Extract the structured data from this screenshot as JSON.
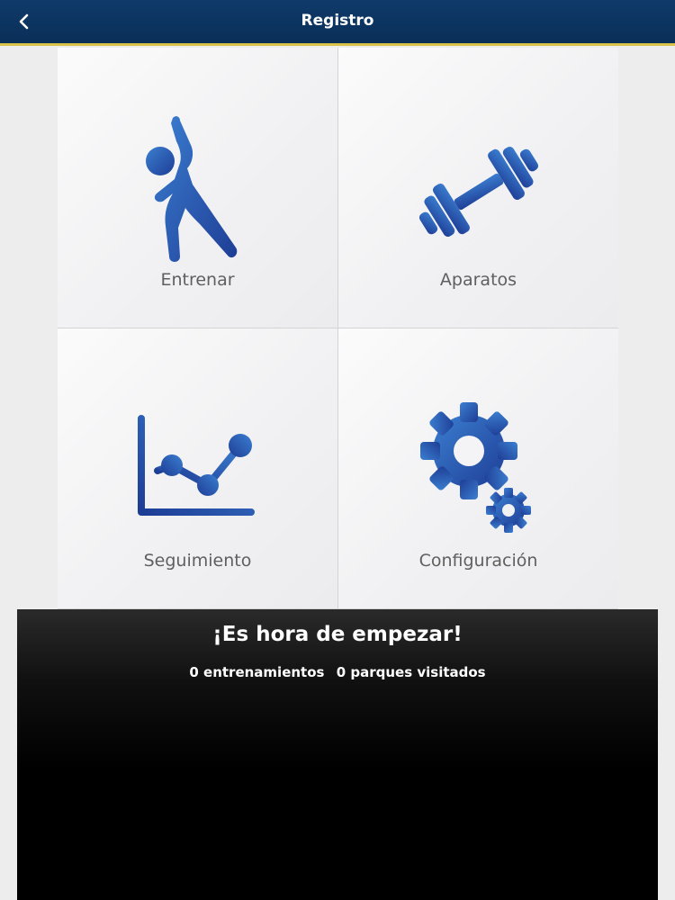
{
  "header": {
    "title": "Registro",
    "back_icon": "chevron-left-icon"
  },
  "menu": [
    {
      "label": "Entrenar",
      "icon": "stretching-person-icon"
    },
    {
      "label": "Aparatos",
      "icon": "dumbbell-icon"
    },
    {
      "label": "Seguimiento",
      "icon": "line-chart-icon"
    },
    {
      "label": "Configuración",
      "icon": "gears-icon"
    }
  ],
  "banner": {
    "title": "¡Es hora de empezar!",
    "workouts": "0 entrenamientos",
    "parks": "0 parques visitados"
  },
  "colors": {
    "header_bg": "#0a2f58",
    "header_border": "#d8c24a",
    "icon_blue_dark": "#1f3f96",
    "icon_blue_light": "#3b7fd1"
  }
}
